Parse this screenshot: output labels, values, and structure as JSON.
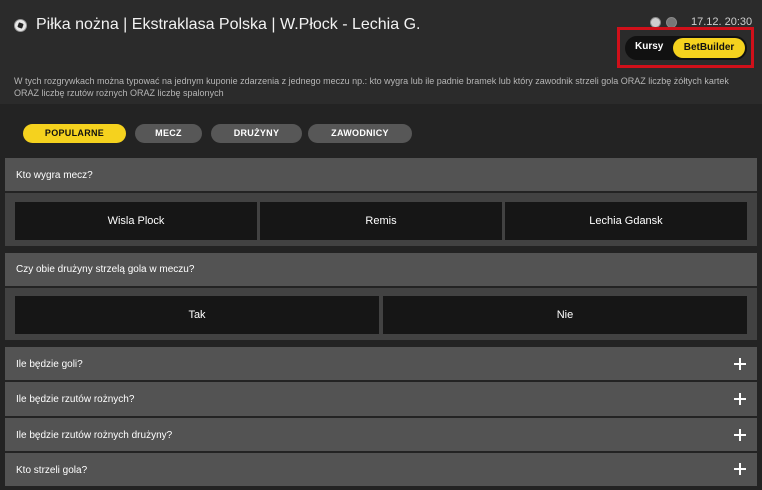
{
  "header": {
    "title": "Piłka nożna | Ekstraklasa Polska | W.Płock - Lechia G.",
    "datetime": "17.12. 20:30",
    "icons": [
      "soccer-ball-icon",
      "stats-icon",
      "live-icon"
    ]
  },
  "toggle": {
    "kursy": "Kursy",
    "betbuilder": "BetBuilder"
  },
  "description": "W tych rozgrywkach można typować na jednym kuponie zdarzenia z jednego meczu np.: kto wygra lub ile padnie bramek lub który zawodnik strzeli gola ORAZ liczbę żółtych kartek ORAZ liczbę rzutów rożnych ORAZ liczbę spalonych",
  "tabs": [
    {
      "label": "POPULARNE",
      "active": true
    },
    {
      "label": "MECZ",
      "active": false
    },
    {
      "label": "DRUŻYNY",
      "active": false
    },
    {
      "label": "ZAWODNICY",
      "active": false
    }
  ],
  "sections": [
    {
      "title": "Kto wygra mecz?",
      "expanded": true,
      "options": [
        "Wisla Plock",
        "Remis",
        "Lechia Gdansk"
      ]
    },
    {
      "title": "Czy obie drużyny strzelą gola w meczu?",
      "expanded": true,
      "options": [
        "Tak",
        "Nie"
      ]
    },
    {
      "title": "Ile będzie goli?",
      "expanded": false
    },
    {
      "title": "Ile będzie rzutów rożnych?",
      "expanded": false
    },
    {
      "title": "Ile będzie rzutów rożnych drużyny?",
      "expanded": false
    },
    {
      "title": "Kto strzeli gola?",
      "expanded": false
    }
  ],
  "colors": {
    "accent": "#f5d21e",
    "highlight": "#d0101a",
    "background": "#232323",
    "section_header": "#535353",
    "odd_button": "#161616"
  }
}
